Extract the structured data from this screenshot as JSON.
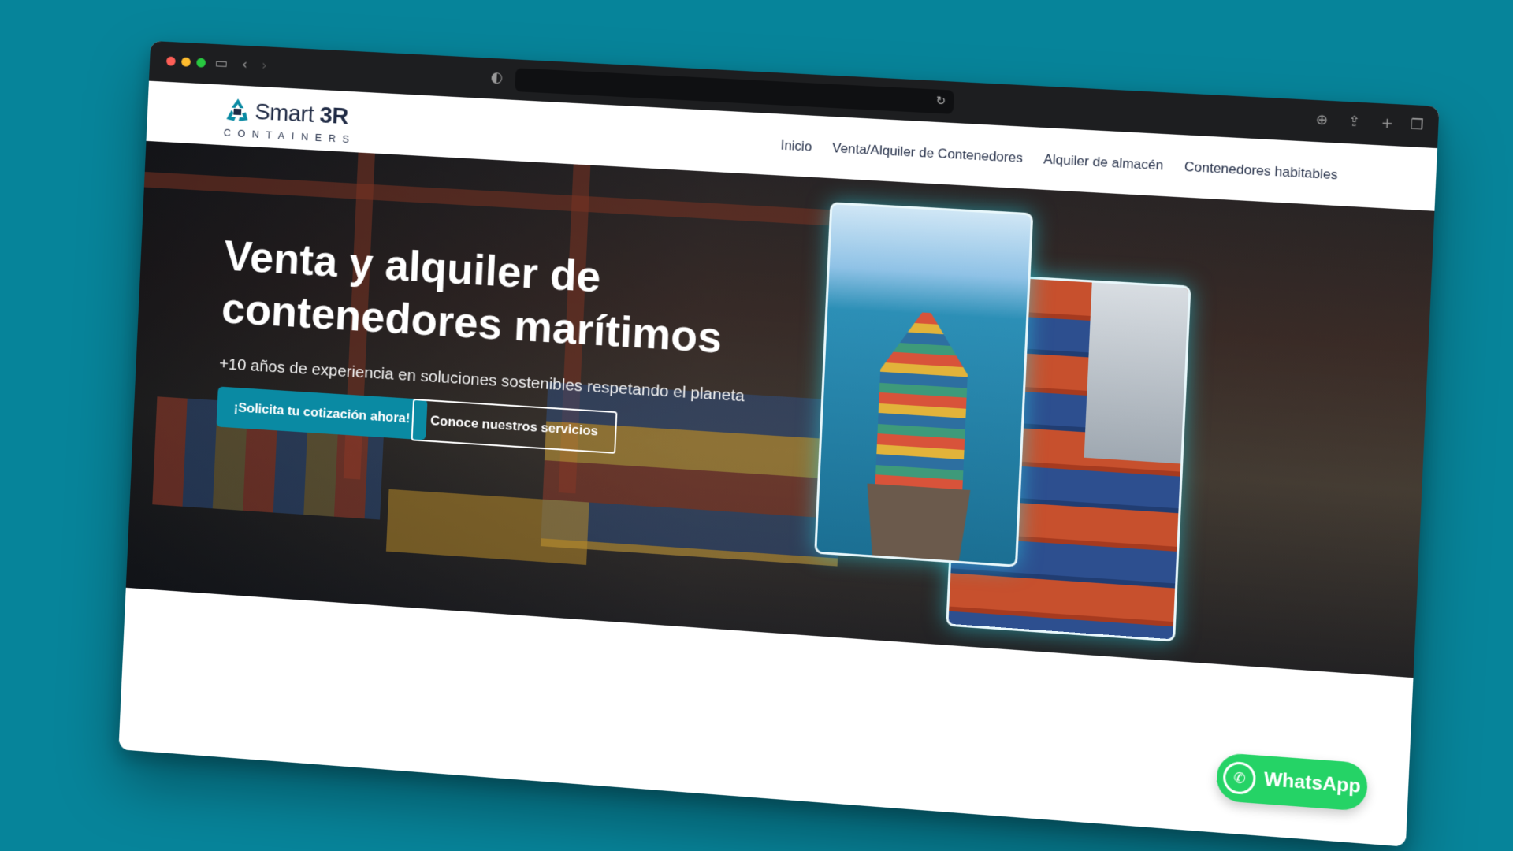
{
  "browser": {
    "icons": [
      "sidebar-icon",
      "back-icon",
      "forward-icon",
      "shield-icon",
      "reload-icon",
      "download-icon",
      "share-icon",
      "new-tab-icon",
      "tabs-icon"
    ]
  },
  "site": {
    "logo_word": "Smart",
    "logo_strong": "3R",
    "logo_sub": "CONTAINERS",
    "nav": [
      "Inicio",
      "Venta/Alquiler de Contenedores",
      "Alquiler de almacén",
      "Contenedores habitables"
    ]
  },
  "hero": {
    "title": "Venta y alquiler de contenedores marítimos",
    "subtitle": "+10 años de experiencia en soluciones sostenibles respetando el planeta",
    "cta_primary": "¡Solicita tu cotización ahora!",
    "cta_secondary": "Conoce nuestros servicios"
  },
  "whatsapp": {
    "label": "WhatsApp"
  },
  "colors": {
    "background": "#06849a",
    "accent": "#0a8aa3",
    "whatsapp": "#25d366",
    "brand_dark": "#1f2a44"
  }
}
